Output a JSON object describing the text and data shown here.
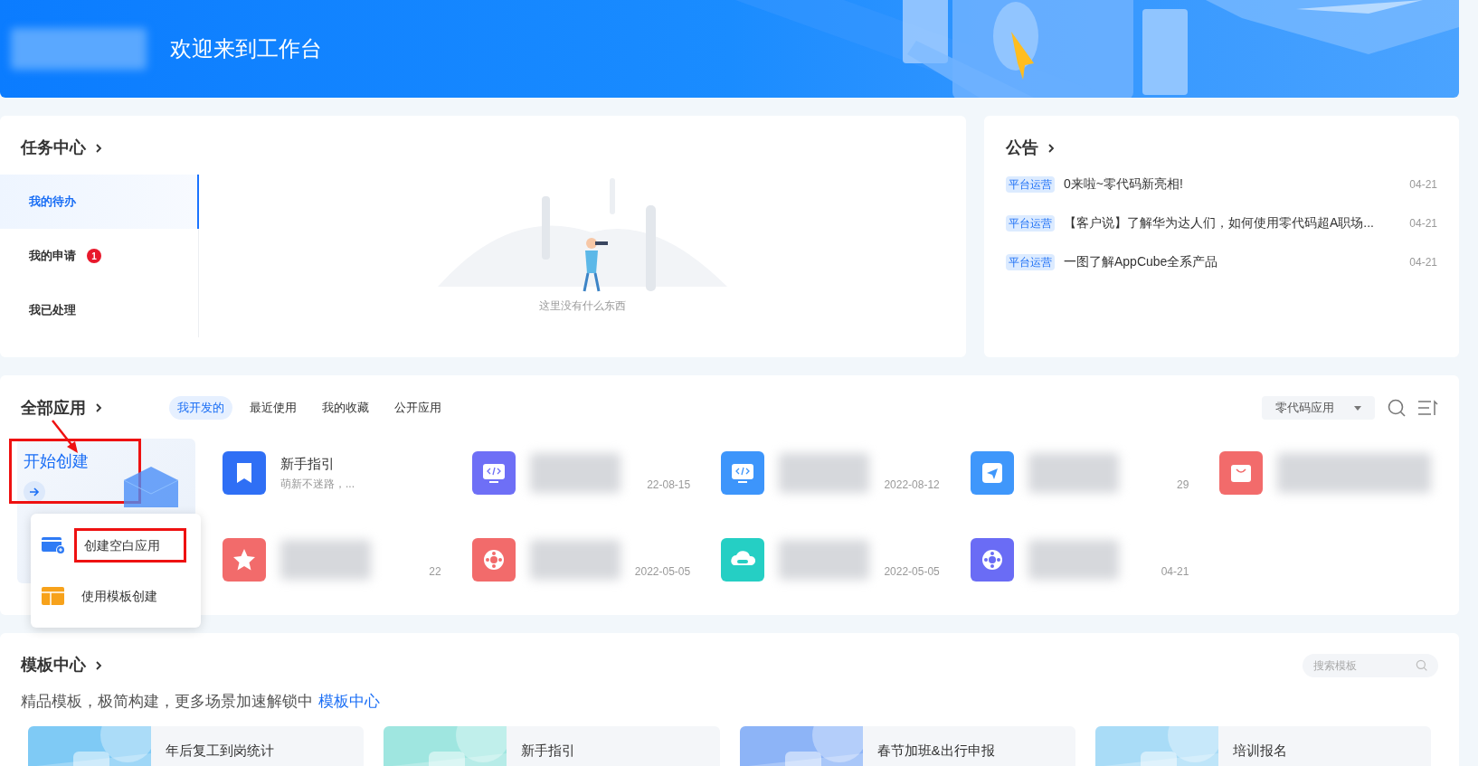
{
  "header": {
    "title": "欢迎来到工作台",
    "logo_blurred": true
  },
  "task_center": {
    "title": "任务中心",
    "tabs": [
      {
        "label": "我的待办",
        "selected": true
      },
      {
        "label": "我的申请",
        "selected": false,
        "badge": "1"
      },
      {
        "label": "我已处理",
        "selected": false
      }
    ],
    "empty_text": "这里没有什么东西"
  },
  "notices": {
    "title": "公告",
    "items": [
      {
        "tag": "平台运营",
        "text": "0来啦~零代码新亮相!",
        "date": "04-21"
      },
      {
        "tag": "平台运营",
        "text": "【客户说】了解华为达人们，如何使用零代码超A职场...",
        "date": "04-21"
      },
      {
        "tag": "平台运营",
        "text": "一图了解AppCube全系产品",
        "date": "04-21"
      }
    ]
  },
  "apps": {
    "title": "全部应用",
    "tabs": [
      {
        "label": "我开发的",
        "selected": true
      },
      {
        "label": "最近使用",
        "selected": false
      },
      {
        "label": "我的收藏",
        "selected": false
      },
      {
        "label": "公开应用",
        "selected": false
      }
    ],
    "filter": "零代码应用",
    "start": {
      "label": "开始创建",
      "annotated": true
    },
    "menu": [
      {
        "kind": "blank",
        "label": "创建空白应用",
        "annotated": true
      },
      {
        "kind": "template",
        "label": "使用模板创建",
        "annotated": false
      }
    ],
    "items": [
      {
        "kind": "book",
        "color": "#2f6ff5",
        "name": "新手指引",
        "desc": "萌新不迷路，...",
        "blurred": false
      },
      {
        "kind": "code",
        "color": "#6e6ff6",
        "date": "22-08-15",
        "blurred": true
      },
      {
        "kind": "code",
        "color": "#3d95fb",
        "date": "2022-08-12",
        "blurred": true
      },
      {
        "kind": "send",
        "color": "#3f97fb",
        "date": "29",
        "blurred": true
      },
      {
        "kind": "bag",
        "color": "#f26b6b",
        "blurred": true
      },
      {
        "kind": "star",
        "color": "#f26b6b",
        "date": "22",
        "blurred": true
      },
      {
        "kind": "ring",
        "color": "#f26b6b",
        "date": "2022-05-05",
        "blurred": true
      },
      {
        "kind": "cloud",
        "color": "#25cfc4",
        "date": "2022-05-05",
        "blurred": true
      },
      {
        "kind": "ring",
        "color": "#6a6cf5",
        "date": "04-21",
        "blurred": true
      }
    ]
  },
  "templates": {
    "title": "模板中心",
    "search_placeholder": "搜索模板",
    "subtitle": "精品模板，极简构建，更多场景加速解锁中",
    "link": "模板中心",
    "items": [
      {
        "name": "年后复工到岗统计"
      },
      {
        "name": "新手指引"
      },
      {
        "name": "春节加班&出行申报"
      },
      {
        "name": "培训报名"
      }
    ]
  }
}
